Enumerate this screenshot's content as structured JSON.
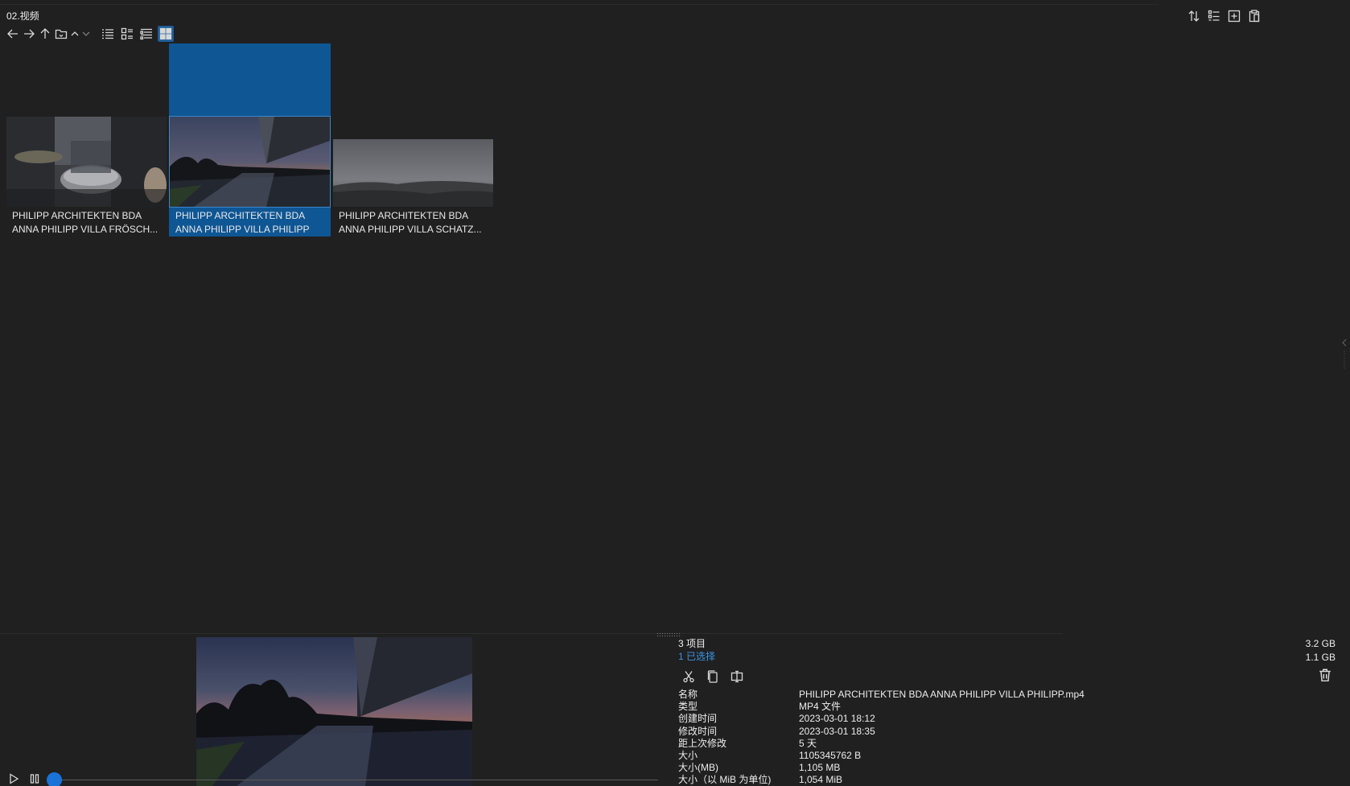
{
  "window": {
    "folder_title": "02.视频"
  },
  "toolbar": {
    "left_icons": [
      "back-arrow-icon",
      "forward-arrow-icon",
      "up-arrow-icon",
      "folder-icon",
      "chevron-up-icon",
      "chevron-down-icon",
      "details-view-icon",
      "tiles-view-icon",
      "list-view-icon",
      "thumbnails-view-icon"
    ],
    "right_icons": [
      "sort-icon",
      "group-icon",
      "add-icon",
      "paste-icon"
    ]
  },
  "files": [
    {
      "line1": "PHILIPP ARCHITEKTEN BDA",
      "line2": "ANNA PHILIPP  VILLA FRÖSCH...",
      "selected": false
    },
    {
      "line1": "PHILIPP ARCHITEKTEN BDA",
      "line2": "ANNA PHILIPP  VILLA PHILIPP",
      "selected": true
    },
    {
      "line1": "PHILIPP ARCHITEKTEN BDA",
      "line2": "ANNA PHILIPP  VILLA SCHATZ...",
      "selected": false
    }
  ],
  "status": {
    "item_count": "3 项目",
    "selected_count": "1 已选择",
    "total_size": "3.2 GB",
    "selected_size": "1.1 GB"
  },
  "details": {
    "name_label": "名称",
    "name_value": "PHILIPP ARCHITEKTEN BDA  ANNA PHILIPP  VILLA PHILIPP.mp4",
    "type_label": "类型",
    "type_value": "MP4 文件",
    "created_label": "创建时间",
    "created_value": "2023-03-01  18:12",
    "modified_label": "修改时间",
    "modified_value": "2023-03-01  18:35",
    "since_label": "距上次修改",
    "since_value": "5 天",
    "size_label": "大小",
    "size_value": "1105345762 B",
    "size_mb_label": "大小(MB)",
    "size_mb_value": "1,105 MB",
    "size_mib_label": "大小（以 MiB 为单位)",
    "size_mib_value": "1,054 MiB"
  },
  "player": {
    "progress": 0
  },
  "colors": {
    "background": "#202020",
    "selection": "#0e5694",
    "accent": "#1a73d8"
  }
}
